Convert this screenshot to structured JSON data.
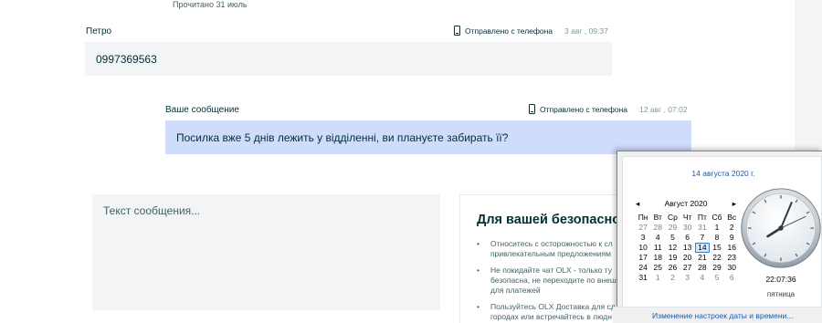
{
  "chat": {
    "read_status": "Прочитано 31 июль",
    "messages": [
      {
        "sender": "Петро",
        "device": "Отправлено с телефона",
        "date": "3 авг , 09:37",
        "text": "0997369563"
      },
      {
        "sender": "Ваше сообщение",
        "device": "Отправлено с телефона",
        "date": "12 авг , 07:02",
        "text": "Посилка вже 5 днів лежить у відділенні, ви плануєте забирать її?"
      }
    ],
    "composer_placeholder": "Текст сообщения..."
  },
  "safety": {
    "title": "Для вашей безопасности",
    "tips": [
      [
        "Относитесь с осторожностью к сл",
        "привлекательным предложениям"
      ],
      [
        "Не покидайте чат OLX - только ту",
        "безопасна, не переходите по внеш",
        "для платежей"
      ],
      [
        "Пользуйтесь OLX Доставка для сд",
        "городах или встречайтесь в людн"
      ]
    ]
  },
  "calendar": {
    "date_link": "14 августа 2020 г.",
    "month": "Август 2020",
    "prev": "◂",
    "next": "▸",
    "weekdays": [
      "Пн",
      "Вт",
      "Ср",
      "Чт",
      "Пт",
      "Сб",
      "Вс"
    ],
    "weeks": [
      [
        {
          "d": "27",
          "o": true
        },
        {
          "d": "28",
          "o": true
        },
        {
          "d": "29",
          "o": true
        },
        {
          "d": "30",
          "o": true
        },
        {
          "d": "31",
          "o": true
        },
        {
          "d": "1"
        },
        {
          "d": "2"
        }
      ],
      [
        {
          "d": "3"
        },
        {
          "d": "4"
        },
        {
          "d": "5"
        },
        {
          "d": "6"
        },
        {
          "d": "7"
        },
        {
          "d": "8"
        },
        {
          "d": "9"
        }
      ],
      [
        {
          "d": "10"
        },
        {
          "d": "11"
        },
        {
          "d": "12"
        },
        {
          "d": "13"
        },
        {
          "d": "14",
          "t": true
        },
        {
          "d": "15"
        },
        {
          "d": "16"
        }
      ],
      [
        {
          "d": "17"
        },
        {
          "d": "18"
        },
        {
          "d": "19"
        },
        {
          "d": "20"
        },
        {
          "d": "21"
        },
        {
          "d": "22"
        },
        {
          "d": "23"
        }
      ],
      [
        {
          "d": "24"
        },
        {
          "d": "25"
        },
        {
          "d": "26"
        },
        {
          "d": "27"
        },
        {
          "d": "28"
        },
        {
          "d": "29"
        },
        {
          "d": "30"
        }
      ],
      [
        {
          "d": "31"
        },
        {
          "d": "1",
          "o": true
        },
        {
          "d": "2",
          "o": true
        },
        {
          "d": "3",
          "o": true
        },
        {
          "d": "4",
          "o": true
        },
        {
          "d": "5",
          "o": true
        },
        {
          "d": "6",
          "o": true
        }
      ]
    ],
    "time": "22:07:36",
    "day": "пятница",
    "footer_link": "Изменение настроек даты и времени..."
  }
}
